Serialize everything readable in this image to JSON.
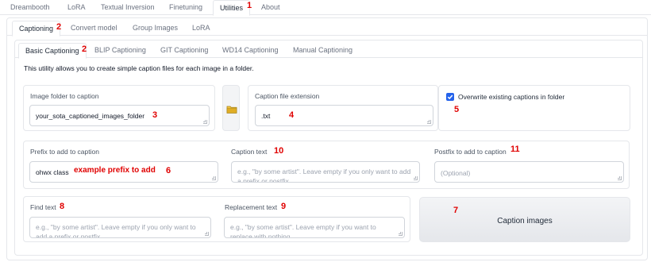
{
  "top_tabs": [
    "Dreambooth",
    "LoRA",
    "Textual Inversion",
    "Finetuning",
    "Utilities",
    "About"
  ],
  "top_tabs_active": "Utilities",
  "sub_tabs": [
    "Captioning",
    "Convert model",
    "Group Images",
    "LoRA"
  ],
  "sub_tabs_active": "Captioning",
  "caption_tabs": [
    "Basic Captioning",
    "BLIP Captioning",
    "GIT Captioning",
    "WD14 Captioning",
    "Manual Captioning"
  ],
  "caption_tabs_active": "Basic Captioning",
  "description": "This utility allows you to create simple caption files for each image in a folder.",
  "image_folder": {
    "label": "Image folder to caption",
    "value": "your_sota_captioned_images_folder"
  },
  "folder_button": {
    "icon": "folder-icon"
  },
  "caption_extension": {
    "label": "Caption file extension",
    "value": ".txt"
  },
  "overwrite": {
    "label": "Overwrite existing captions in folder",
    "checked": true
  },
  "prefix": {
    "label": "Prefix to add to caption",
    "value": "ohwx class",
    "annotation": "example prefix to add"
  },
  "caption_text": {
    "label": "Caption text",
    "placeholder": "e.g., \"by some artist\". Leave empty if you only want to add a prefix or postfix."
  },
  "postfix": {
    "label": "Postfix to add to caption",
    "placeholder": "(Optional)"
  },
  "find_text": {
    "label": "Find text",
    "placeholder": "e.g., \"by some artist\". Leave empty if you only want to add a prefix or postfix."
  },
  "replacement_text": {
    "label": "Replacement text",
    "placeholder": "e.g., \"by some artist\". Leave empty if you want to replace with nothing."
  },
  "caption_button": {
    "label": "Caption images"
  },
  "markers": [
    "1",
    "2",
    "2",
    "3",
    "4",
    "5",
    "6",
    "7",
    "8",
    "9",
    "10",
    "11"
  ],
  "colors": {
    "accent": "#2563eb",
    "marker": "#e00000",
    "border": "#e5e7eb"
  }
}
